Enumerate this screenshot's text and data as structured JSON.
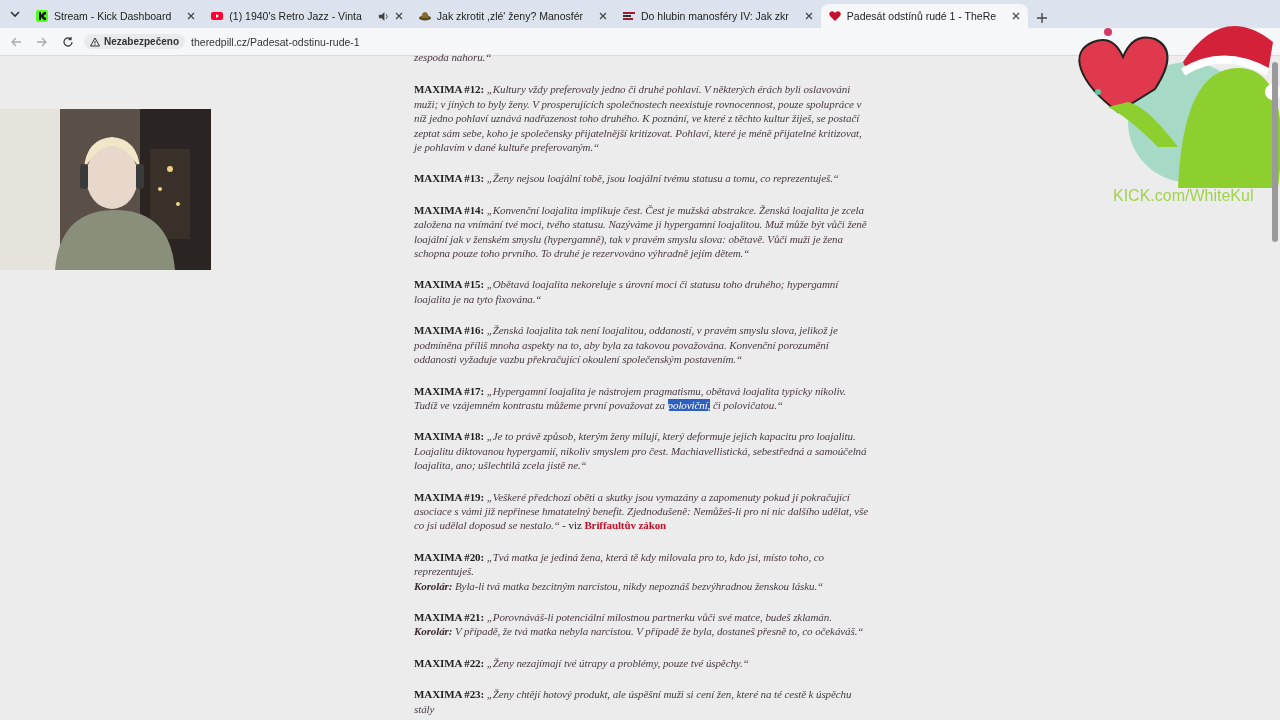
{
  "tabs": [
    {
      "title": "Stream - Kick Dashboard",
      "selected": false,
      "kind": "square",
      "audio": false
    },
    {
      "title": "(1) 1940's Retro Jazz - Vinta",
      "selected": false,
      "kind": "play",
      "audio": true
    },
    {
      "title": "Jak zkrotit ,zlé' ženy? Manosfér",
      "selected": false,
      "kind": "hat",
      "audio": false
    },
    {
      "title": "Do hlubin manosféry IV: Jak zkr",
      "selected": false,
      "kind": "bars",
      "audio": false
    },
    {
      "title": "Padesát odstínů rudé 1 - TheRe",
      "selected": true,
      "kind": "heart",
      "audio": false
    }
  ],
  "address_bar": {
    "security": "Nezabezpečeno",
    "url": "theredpill.cz/Padesat-odstinu-rude-1"
  },
  "overlay": {
    "channel": "KICK.com/WhiteKul"
  },
  "article": {
    "top_fragment": "zespoda nahoru.“",
    "maxims": [
      {
        "label": "MAXIMA #12:",
        "quote": "„Kultury vždy preferovaly jedno či druhé pohlaví. V některých érách byli oslavováni muži; v jiných to byly ženy. V prosperujících společnostech neexistuje rovnocennost, pouze spolupráce v níž jedno pohlaví uznává nadřazenost toho druhého. K poznání, ve které z těchto kultur žiješ, se postačí zeptat sám sebe, koho je společensky přijatelnější kritizovat. Pohlaví, které je méně přijatelné kritizovat, je pohlavím v dané kultuře preferovaným.“"
      },
      {
        "label": "MAXIMA #13:",
        "quote": "„Ženy nejsou loajální tobě, jsou loajální tvému statusu a tomu, co reprezentuješ.“"
      },
      {
        "label": "MAXIMA #14:",
        "quote": "„Konvenční loajalita implikuje čest. Čest je mužská abstrakce. Ženská loajalita je zcela založena na vnímání tvé moci, tvého statusu. Nazýváme ji hypergamní loajalitou. Muž může být vůči ženě loajální jak v ženském smyslu (hypergamně), tak v pravém smyslu slova: obětavě. Vůči muži je žena schopna pouze toho prvního. To druhé je rezervováno výhradně jejím dětem.“"
      },
      {
        "label": "MAXIMA #15:",
        "quote": "„Obětavá loajalita nekoreluje s úrovní moci či statusu toho druhého; hypergamní loajalita je na tyto fixována.“"
      },
      {
        "label": "MAXIMA #16:",
        "quote": "„Ženská loajalita tak není loajalitou, oddaností, v pravém smyslu slova, jelikož je podmíněna příliš mnoha aspekty na to, aby byla za takovou považována. Konvenční porozumění oddanosti vyžaduje vazbu překračující okoulení společenským postavením.“"
      },
      {
        "label": "MAXIMA #17:",
        "quote": [
          {
            "text": "„Hypergamní loajalita je nástrojem pragmatismu, obětavá loajalita typicky nikoliv. Tudíž ve vzájemném kontrastu můžeme první považovat za ",
            "highlighted": false
          },
          {
            "text": "poloviční,",
            "highlighted": true
          },
          {
            "text": " či polovičatou.“",
            "highlighted": false
          }
        ]
      },
      {
        "label": "MAXIMA #18:",
        "quote": "„Je to právě způsob, kterým ženy milují, který deformuje jejich kapacitu pro loajalitu. Loajalitu diktovanou hypergamií, nikoliv smyslem pro čest. Machiavellistická, sebestředná a samoúčelná loajalita, ano; ušlechtilá zcela jistě ne.“"
      },
      {
        "label": "MAXIMA #19:",
        "quote": "„Veškeré předchozí oběti a skutky jsou vymazány a zapomenuty pokud jí pokračující asociace s vámi již nepřinese hmatatelný benefit. Zjednodušeně: Nemůžeš-li pro ni nic dalšího udělat, vše co jsi udělal doposud se nestalo.“",
        "suffix": " - viz ",
        "link": "Briffaultův zákon"
      },
      {
        "label": "MAXIMA #20:",
        "quote": "„Tvá matka je jediná žena, která tě kdy milovala pro to, kdo jsi, místo toho, co reprezentuješ.",
        "corollary_label": "Korolár:",
        "corollary": "Byla-li tvá matka bezcitným narcistou, nikdy nepoznáš bezvýhradnou ženskou lásku.“"
      },
      {
        "label": "MAXIMA #21:",
        "quote": "„Porovnáváš-li potenciální milostnou partnerku vůči své matce, budeš zklamán.",
        "corollary_label": "Korolár:",
        "corollary": "V případě, že tvá matka nebyla narcistou. V případě že byla, dostaneš přesně to, co očekáváš.“"
      },
      {
        "label": "MAXIMA #22:",
        "quote": "„Ženy nezajímají tvé útrapy a problémy, pouze tvé úspěchy.“"
      },
      {
        "label": "MAXIMA #23:",
        "quote": "„Ženy chtějí hotový produkt, ale úspěšní muži si cení žen, které na té cestě k úspěchu stály"
      }
    ]
  }
}
